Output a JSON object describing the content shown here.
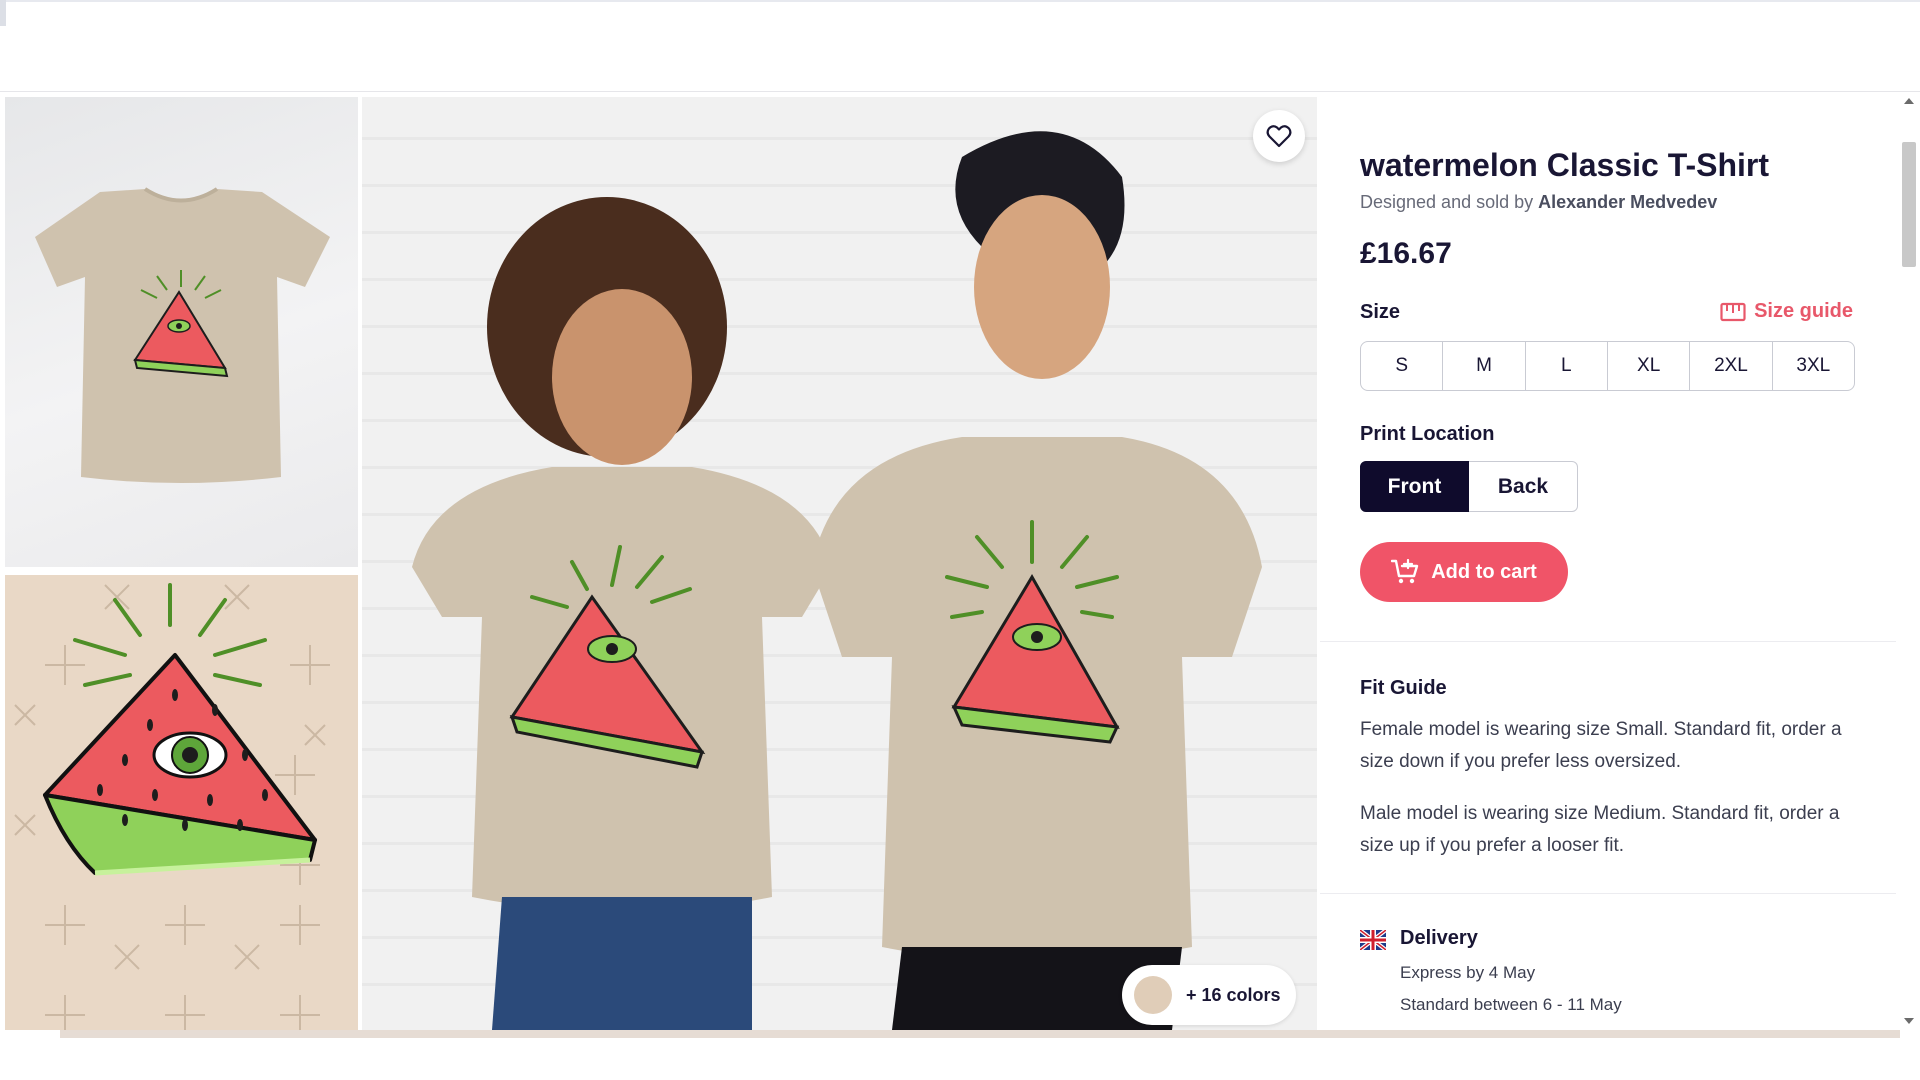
{
  "product": {
    "title": "watermelon Classic T-Shirt",
    "byline_prefix": "Designed and sold by",
    "artist": "Alexander Medvedev",
    "price": "£16.67"
  },
  "size": {
    "label": "Size",
    "guide_label": "Size guide",
    "options": [
      "S",
      "M",
      "L",
      "XL",
      "2XL",
      "3XL"
    ]
  },
  "print_location": {
    "label": "Print Location",
    "options": [
      "Front",
      "Back"
    ],
    "selected": "Front"
  },
  "cart": {
    "label": "Add to cart"
  },
  "colors": {
    "label": "+ 16 colors",
    "selected_swatch": "#e0cdb8"
  },
  "fit_guide": {
    "title": "Fit Guide",
    "female": "Female model is wearing size Small. Standard fit, order a size down if you prefer less oversized.",
    "male": "Male model is wearing size Medium. Standard fit, order a size up if you prefer a looser fit."
  },
  "delivery": {
    "title": "Delivery",
    "express": "Express by 4 May",
    "standard": "Standard between 6 - 11 May"
  },
  "theme": {
    "accent": "#f05468",
    "dark": "#0f0b2c",
    "shirt": "#cfc2ae",
    "watermelon": "#ec5a5f",
    "rind": "#8fd15a"
  },
  "icons": [
    "heart-icon",
    "ruler-icon",
    "cart-icon",
    "uk-flag-icon"
  ]
}
